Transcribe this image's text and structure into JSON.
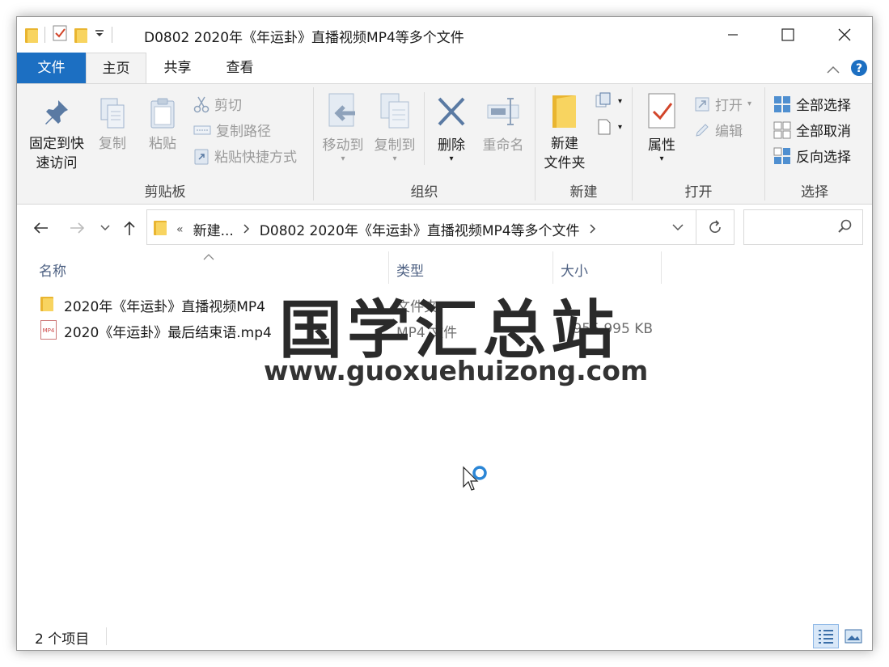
{
  "window": {
    "title": "D0802 2020年《年运卦》直播视频MP4等多个文件",
    "minimize": "—",
    "maximize": "☐",
    "close": "✕"
  },
  "tabs": {
    "file": "文件",
    "home": "主页",
    "share": "共享",
    "view": "查看",
    "help": "?"
  },
  "ribbon": {
    "clipboard": {
      "label": "剪贴板",
      "pin_line1": "固定到快",
      "pin_line2": "速访问",
      "copy": "复制",
      "paste": "粘贴",
      "cut": "剪切",
      "copy_path": "复制路径",
      "paste_shortcut": "粘贴快捷方式"
    },
    "organize": {
      "label": "组织",
      "move_to": "移动到",
      "copy_to": "复制到",
      "delete": "删除",
      "rename": "重命名"
    },
    "new": {
      "label": "新建",
      "new_folder_line1": "新建",
      "new_folder_line2": "文件夹"
    },
    "open": {
      "label": "打开",
      "properties": "属性",
      "open": "打开",
      "edit": "编辑"
    },
    "select": {
      "label": "选择",
      "select_all": "全部选择",
      "select_none": "全部取消",
      "invert": "反向选择"
    }
  },
  "address": {
    "overflow": "«",
    "crumbs": [
      "新建...",
      "D0802 2020年《年运卦》直播视频MP4等多个文件"
    ],
    "search_placeholder": ""
  },
  "columns": {
    "name": "名称",
    "type": "类型",
    "size": "大小"
  },
  "files": [
    {
      "name": "2020年《年运卦》直播视频MP4",
      "type": "文件夹",
      "size": "",
      "icon": "folder-icon"
    },
    {
      "name": "2020《年运卦》最后结束语.mp4",
      "type": "MP4 文件",
      "size": "955,995 KB",
      "icon": "mp4-file-icon"
    }
  ],
  "watermark": {
    "title": "国学汇总站",
    "url": "www.guoxuehuizong.com"
  },
  "status": {
    "item_count": "2 个项目"
  },
  "colors": {
    "file_tab": "#1c6fc2",
    "ribbon_bg": "#f3f3f3",
    "column_header": "#4d6082",
    "folder": "#f8d460"
  }
}
